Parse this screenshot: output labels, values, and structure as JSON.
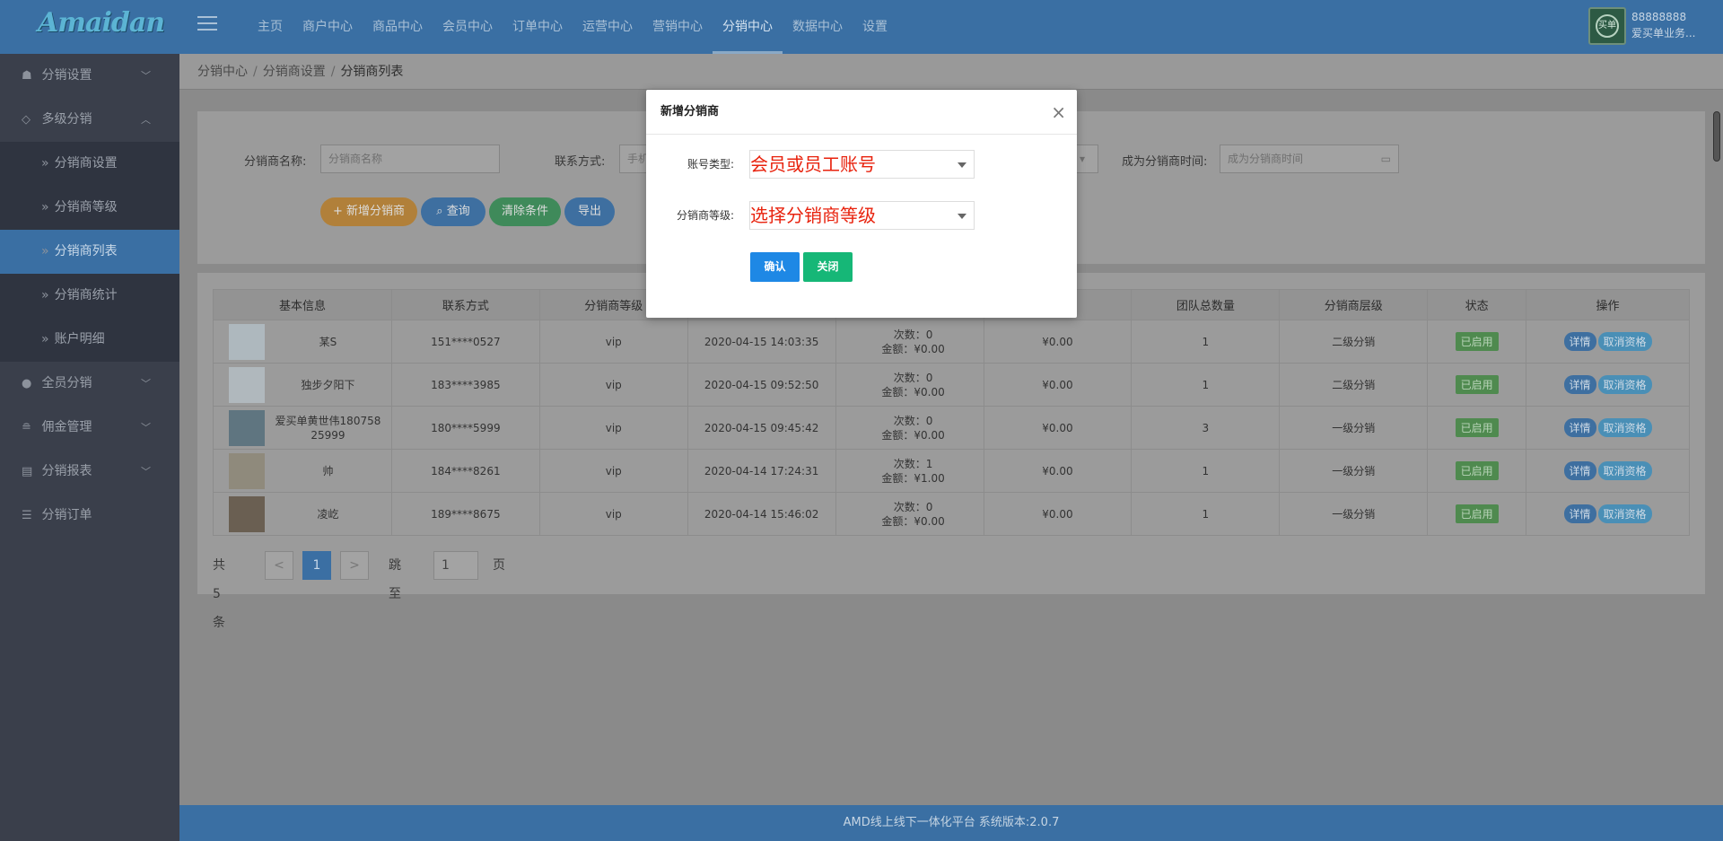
{
  "app": {
    "logo": "Amaidan",
    "top_nav": [
      "主页",
      "商户中心",
      "商品中心",
      "会员中心",
      "订单中心",
      "运营中心",
      "营销中心",
      "分销中心",
      "数据中心",
      "设置"
    ],
    "active_nav": "分销中心",
    "user_id": "88888888",
    "user_name": "爱买单业务...",
    "avatar_text": "买单"
  },
  "sidebar": {
    "groups": [
      {
        "label": "分销设置",
        "icon": "users-icon",
        "chevron": "﹀"
      },
      {
        "label": "多级分销",
        "icon": "diamond-icon",
        "chevron": "︿"
      },
      {
        "label": "全员分销",
        "icon": "person-icon",
        "chevron": "﹀"
      },
      {
        "label": "佣金管理",
        "icon": "database-icon",
        "chevron": "﹀"
      },
      {
        "label": "分销报表",
        "icon": "report-icon",
        "chevron": "﹀"
      },
      {
        "label": "分销订单",
        "icon": "list-icon",
        "chevron": ""
      }
    ],
    "sub_items": [
      "分销商设置",
      "分销商等级",
      "分销商列表",
      "分销商统计",
      "账户明细"
    ],
    "active_sub": "分销商列表"
  },
  "breadcrumb": [
    "分销中心",
    "分销商设置",
    "分销商列表"
  ],
  "filters": {
    "name_label": "分销商名称:",
    "name_placeholder": "分销商名称",
    "contact_label": "联系方式:",
    "contact_placeholder": "手机",
    "time_label": "成为分销商时间:",
    "time_placeholder": "成为分销商时间"
  },
  "buttons": {
    "add": "新增分销商",
    "query": "查询",
    "clear": "清除条件",
    "export": "导出"
  },
  "table": {
    "headers": [
      "基本信息",
      "联系方式",
      "分销商等级",
      "",
      "",
      "",
      "团队总数量",
      "分销商层级",
      "状态",
      "操作"
    ],
    "rows": [
      {
        "name": "某S",
        "phone": "151****0527",
        "level": "vip",
        "time": "2020-04-15 14:03:35",
        "count": "次数：0",
        "amount": "金额：¥0.00",
        "balance": "¥0.00",
        "team": "1",
        "tier": "二级分销",
        "status": "已启用",
        "thumb": "#aeb8be"
      },
      {
        "name": "独步夕阳下",
        "phone": "183****3985",
        "level": "vip",
        "time": "2020-04-15 09:52:50",
        "count": "次数：0",
        "amount": "金额：¥0.00",
        "balance": "¥0.00",
        "team": "1",
        "tier": "二级分销",
        "status": "已启用",
        "thumb": "#b0b8bd"
      },
      {
        "name": "爱买单黄世伟18075825999",
        "phone": "180****5999",
        "level": "vip",
        "time": "2020-04-15 09:45:42",
        "count": "次数：0",
        "amount": "金额：¥0.00",
        "balance": "¥0.00",
        "team": "3",
        "tier": "一级分销",
        "status": "已启用",
        "thumb": "#5f7580"
      },
      {
        "name": "帅",
        "phone": "184****8261",
        "level": "vip",
        "time": "2020-04-14 17:24:31",
        "count": "次数：1",
        "amount": "金额：¥1.00",
        "balance": "¥0.00",
        "team": "1",
        "tier": "一级分销",
        "status": "已启用",
        "thumb": "#8f8a7c"
      },
      {
        "name": "凌屹",
        "phone": "189****8675",
        "level": "vip",
        "time": "2020-04-14 15:46:02",
        "count": "次数：0",
        "amount": "金额：¥0.00",
        "balance": "¥0.00",
        "team": "1",
        "tier": "一级分销",
        "status": "已启用",
        "thumb": "#6a5f52"
      }
    ],
    "op_detail": "详情",
    "op_cancel": "取消资格"
  },
  "pager": {
    "total": "共 5 条",
    "prev": "<",
    "current": "1",
    "next": ">",
    "jump": "跳至",
    "jump_value": "1",
    "page_unit": "页"
  },
  "footer": "AMD线上线下一体化平台 系统版本:2.0.7",
  "modal": {
    "title": "新增分销商",
    "close": "×",
    "account_label": "账号类型:",
    "account_value": "会员或员工账号",
    "level_label": "分销商等级:",
    "level_value": "选择分销商等级",
    "confirm": "确认",
    "close_btn": "关闭"
  },
  "colors": {
    "header": "#3a6fa3",
    "confirm": "#1e88e5",
    "close": "#16b777",
    "alert_text": "#e8220d"
  }
}
